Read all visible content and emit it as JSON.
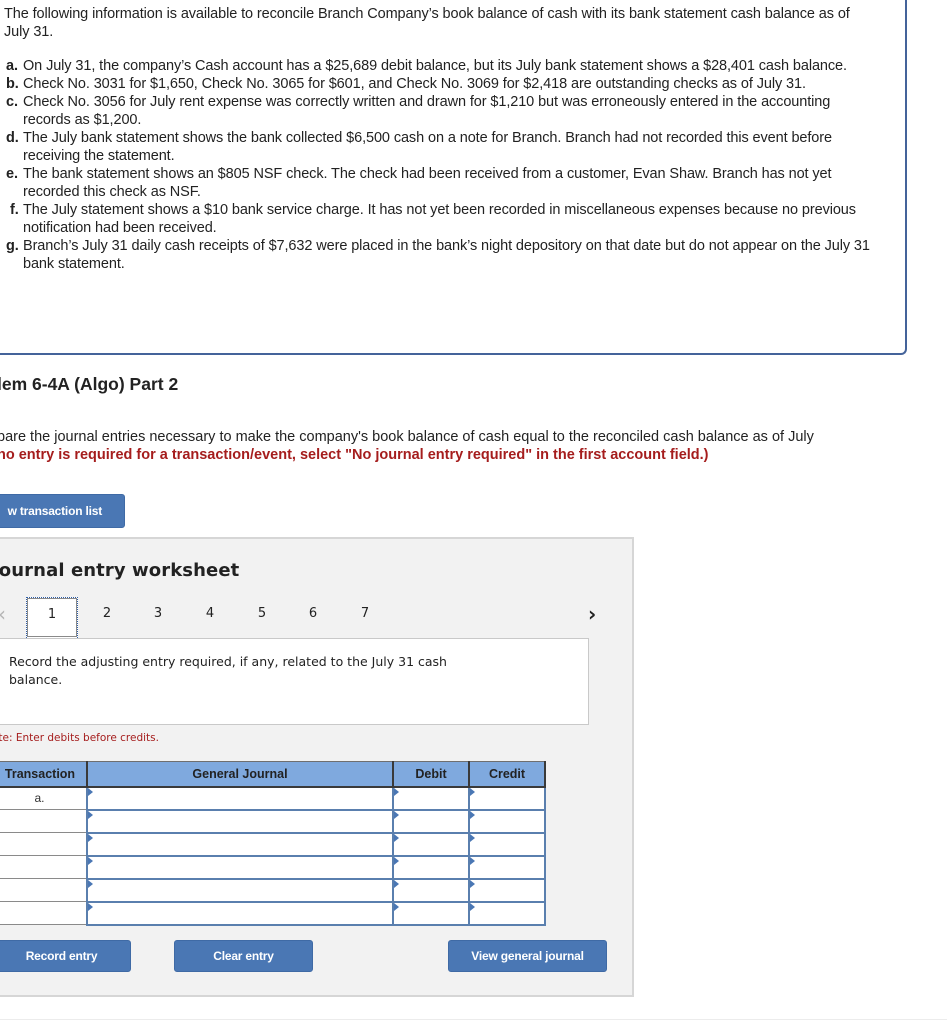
{
  "info": {
    "intro": "The following information is available to reconcile Branch Company’s book balance of cash with its bank statement cash balance as of July 31.",
    "items": [
      {
        "label": "a.",
        "text": "On July 31, the company’s Cash account has a $25,689 debit balance, but its July bank statement shows a $28,401 cash balance."
      },
      {
        "label": "b.",
        "text": "Check No. 3031 for $1,650, Check No. 3065 for $601, and Check No. 3069 for $2,418 are outstanding checks as of July 31."
      },
      {
        "label": "c.",
        "text": "Check No. 3056 for July rent expense was correctly written and drawn for $1,210 but was erroneously entered in the accounting records as $1,200."
      },
      {
        "label": "d.",
        "text": "The July bank statement shows the bank collected $6,500 cash on a note for Branch. Branch had not recorded this event before receiving the statement."
      },
      {
        "label": "e.",
        "text": "The bank statement shows an $805 NSF check. The check had been received from a customer, Evan Shaw. Branch has not yet recorded this check as NSF."
      },
      {
        "label": "f.",
        "text": "The July statement shows a $10 bank service charge. It has not yet been recorded in miscellaneous expenses because no previous notification had been received."
      },
      {
        "label": "g.",
        "text": "Branch’s July 31 daily cash receipts of $7,632 were placed in the bank’s night depository on that date but do not appear on the July 31 bank statement."
      }
    ]
  },
  "part": {
    "title": "lem 6-4A (Algo) Part 2",
    "instruction_line1": "pare the journal entries necessary to make the company's book balance of cash equal to the reconciled cash balance as of July",
    "instruction_line2": "no entry is required for a transaction/event, select \"No journal entry required\" in the first account field.)"
  },
  "buttons": {
    "view_transactions": "w transaction list",
    "record_entry": "Record entry",
    "clear_entry": "Clear entry",
    "view_general_journal": "View general journal"
  },
  "worksheet": {
    "title": "Journal entry worksheet",
    "prev_icon": "‹",
    "next_icon": "›",
    "tabs": [
      "1",
      "2",
      "3",
      "4",
      "5",
      "6",
      "7"
    ],
    "active_tab": "1",
    "prompt": "Record the adjusting entry required, if any, related to the July 31 cash balance.",
    "note": "ote: Enter debits before credits.",
    "columns": [
      "Transaction",
      "General Journal",
      "Debit",
      "Credit"
    ],
    "rows": [
      {
        "transaction": "a.",
        "account": "",
        "debit": "",
        "credit": ""
      },
      {
        "transaction": "",
        "account": "",
        "debit": "",
        "credit": ""
      },
      {
        "transaction": "",
        "account": "",
        "debit": "",
        "credit": ""
      },
      {
        "transaction": "",
        "account": "",
        "debit": "",
        "credit": ""
      },
      {
        "transaction": "",
        "account": "",
        "debit": "",
        "credit": ""
      },
      {
        "transaction": "",
        "account": "",
        "debit": "",
        "credit": ""
      }
    ]
  },
  "colors": {
    "button": "#4a77b4",
    "table_header": "#7fa9de",
    "note_red": "#a51d1d",
    "box_border": "#44639a",
    "worksheet_bg": "#f2f2f2"
  }
}
